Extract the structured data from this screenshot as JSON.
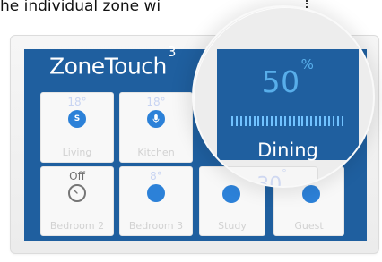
{
  "caption": {
    "text": "he individual zone wi"
  },
  "brand": {
    "name": "ZoneTouch",
    "superscript": "3"
  },
  "zones": {
    "living": {
      "temp": "18°",
      "icon_text": "S",
      "label": "Living"
    },
    "kitchen": {
      "temp": "18°",
      "label": "Kitchen"
    },
    "bedroom2": {
      "temp": "Off",
      "label": "Bedroom 2"
    },
    "bedroom3": {
      "temp": "8°",
      "label": "Bedroom 3"
    },
    "study": {
      "label": "Study"
    },
    "guest": {
      "label": "Guest"
    }
  },
  "zoom": {
    "percent": "50",
    "percent_suffix": "%",
    "zone_name": "Dining",
    "temperature": "30",
    "temperature_suffix": "°",
    "meter_fill": 1.0
  },
  "colors": {
    "screen_blue": "#1f5f9f",
    "accent_blue": "#2c81d8",
    "light_blue": "#58aeea",
    "meter_blue": "#71c2ff"
  },
  "icons": {
    "living": "letter-s-circle-icon",
    "kitchen": "microphone-circle-icon",
    "bedroom2": "dial-icon",
    "bedroom3": "blue-circle-icon"
  }
}
